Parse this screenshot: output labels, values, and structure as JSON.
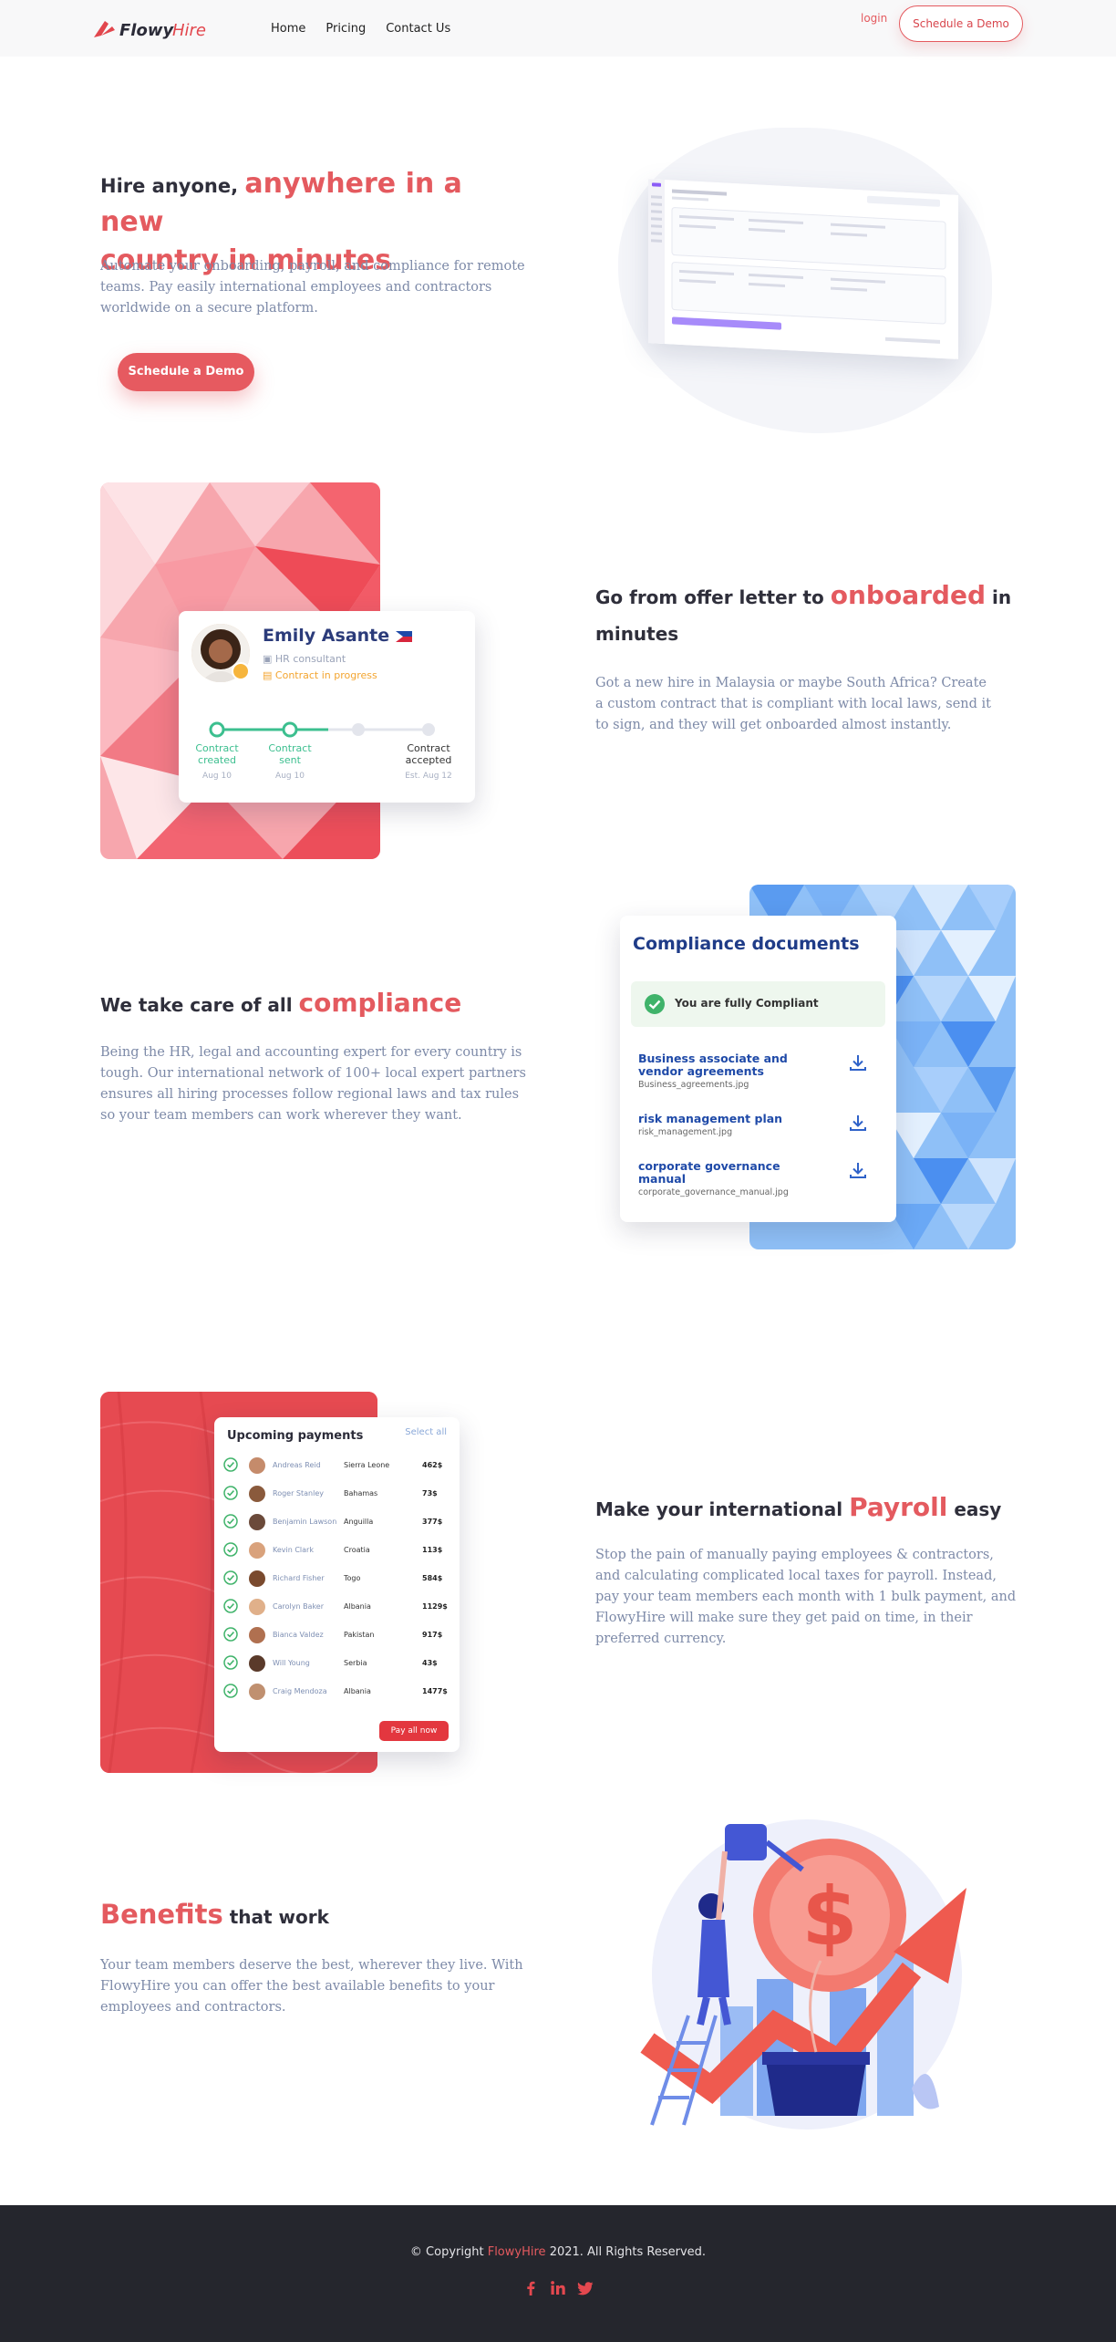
{
  "header": {
    "brand": "FlowyHire",
    "nav": [
      "Home",
      "Pricing",
      "Contact Us"
    ],
    "login": "login",
    "demo": "Schedule a Demo"
  },
  "hero": {
    "title_plain": "Hire anyone,",
    "title_accent_1": "anywhere in a new",
    "title_accent_2": "country in minutes",
    "body": "Automate your onboarding, payroll, and compliance for remote teams. Pay easily international employees and contractors worldwide on a secure platform.",
    "cta": "Schedule a Demo"
  },
  "onboard": {
    "title_pre": "Go from offer letter to",
    "title_accent": "onboarded",
    "title_post": "in",
    "title_line2": "minutes",
    "body": "Got a new hire in Malaysia or maybe South Africa? Create a custom contract that is compliant with local laws, send it to sign, and they will get onboarded almost instantly.",
    "card": {
      "name": "Emily Asante",
      "role": "HR consultant",
      "status": "Contract in progress",
      "steps": [
        {
          "label": "Contract\ncreated",
          "date": "Aug 10"
        },
        {
          "label": "Contract\nsent",
          "date": "Aug 10"
        },
        {
          "label": "Contract\naccepted",
          "date": "Est. Aug 12"
        }
      ]
    }
  },
  "compliance": {
    "title_pre": "We take care of all",
    "title_accent": "compliance",
    "body": "Being the HR, legal and accounting expert for every country is tough. Our international network of 100+ local expert partners ensures all hiring processes follow regional laws and tax rules so your team members can work wherever they want.",
    "card": {
      "title": "Compliance documents",
      "status": "You are fully Compliant",
      "docs": [
        {
          "name": "Business associate and vendor agreements",
          "file": "Business_agreements.jpg"
        },
        {
          "name": "risk management plan",
          "file": "risk_management.jpg"
        },
        {
          "name": "corporate governance manual",
          "file": "corporate_governance_manual.jpg"
        }
      ]
    }
  },
  "payroll": {
    "title_pre": "Make your international",
    "title_accent": "Payroll",
    "title_post": "easy",
    "body": "Stop the pain of manually paying employees & contractors, and calculating complicated local taxes for payroll. Instead, pay your team members each month with 1 bulk payment, and FlowyHire will make sure they get paid on time, in their preferred currency.",
    "card": {
      "title": "Upcoming payments",
      "select_all": "Select all",
      "pay_all": "Pay all now",
      "rows": [
        {
          "name": "Andreas Reid",
          "country": "Sierra Leone",
          "amount": "462$"
        },
        {
          "name": "Roger Stanley",
          "country": "Bahamas",
          "amount": "73$"
        },
        {
          "name": "Benjamin Lawson",
          "country": "Anguilla",
          "amount": "377$"
        },
        {
          "name": "Kevin Clark",
          "country": "Croatia",
          "amount": "113$"
        },
        {
          "name": "Richard Fisher",
          "country": "Togo",
          "amount": "584$"
        },
        {
          "name": "Carolyn Baker",
          "country": "Albania",
          "amount": "1129$"
        },
        {
          "name": "Bianca Valdez",
          "country": "Pakistan",
          "amount": "917$"
        },
        {
          "name": "Will Young",
          "country": "Serbia",
          "amount": "43$"
        },
        {
          "name": "Craig Mendoza",
          "country": "Albania",
          "amount": "1477$"
        }
      ]
    }
  },
  "benefits": {
    "title_accent": "Benefits",
    "title_post": "that work",
    "body": "Your team members deserve the best, wherever they live. With FlowyHire you can offer the best available benefits to your employees and contractors."
  },
  "footer": {
    "copy_pre": "© Copyright",
    "copy_brand": "FlowyHire",
    "copy_post": "2021. All Rights Reserved.",
    "social": [
      "facebook-icon",
      "linkedin-icon",
      "twitter-icon"
    ]
  },
  "colors": {
    "accent": "#e45a5f",
    "navy": "#1f3c88",
    "footer": "#25262d"
  }
}
